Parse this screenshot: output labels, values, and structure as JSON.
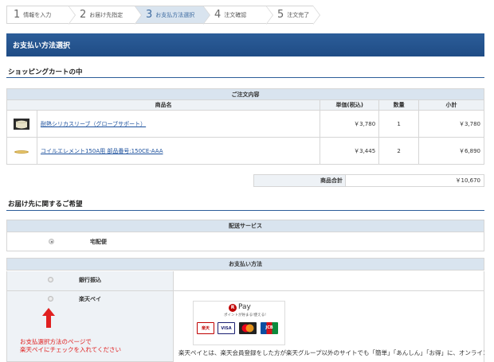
{
  "steps": [
    {
      "num": "1",
      "label": "情報を入力"
    },
    {
      "num": "2",
      "label": "お届け先指定"
    },
    {
      "num": "3",
      "label": "お支払方法選択"
    },
    {
      "num": "4",
      "label": "注文確認"
    },
    {
      "num": "5",
      "label": "注文完了"
    }
  ],
  "active_step": 3,
  "header": {
    "title": "お支払い方法選択"
  },
  "cart": {
    "section_title": "ショッピングカートの中",
    "caption": "ご注文内容",
    "columns": [
      "商品名",
      "単価(税込)",
      "数量",
      "小計"
    ],
    "items": [
      {
        "name": "耐熱シリカスリーブ（グローブサポート）",
        "price": "￥3,780",
        "qty": "1",
        "subtotal": "￥3,780",
        "thumb_icon": "sleeve-product-image"
      },
      {
        "name": "コイルエレメント150A用 部品番号:150CE-AAA",
        "price": "￥3,445",
        "qty": "2",
        "subtotal": "￥6,890",
        "thumb_icon": "coil-product-image"
      }
    ],
    "total_label": "商品合計",
    "total_value": "￥10,670"
  },
  "delivery": {
    "section_title": "お届け先に関するご希望",
    "service_header": "配送サービス",
    "option": "宅配便"
  },
  "payment": {
    "header": "お支払い方法",
    "options": [
      {
        "label": "銀行振込"
      },
      {
        "label": "楽天ペイ"
      }
    ],
    "rpay_text": "Pay",
    "rpay_r": "R",
    "rpay_sub": "ポイントが貯まる!使える!",
    "cards": [
      "楽天",
      "VISA",
      "MC",
      "JCB"
    ],
    "description": "楽天ペイとは、楽天会員登録をした方が楽天グループ以外のサイトでも「簡単」「あんしん」「お得」に、オンライン決済をすることができるサービスです。楽天ペイを使えば、普段ご利用いただいているクレ"
  },
  "annotation": {
    "line1": "お支払選択方法のページで",
    "line2": "楽天ペイにチェックを入れてください",
    "color": "#e02020"
  },
  "colors": {
    "primary": "#2c5d99",
    "light": "#d9e4ef",
    "link": "#1a4f9c",
    "rakuten_red": "#bf0000"
  }
}
